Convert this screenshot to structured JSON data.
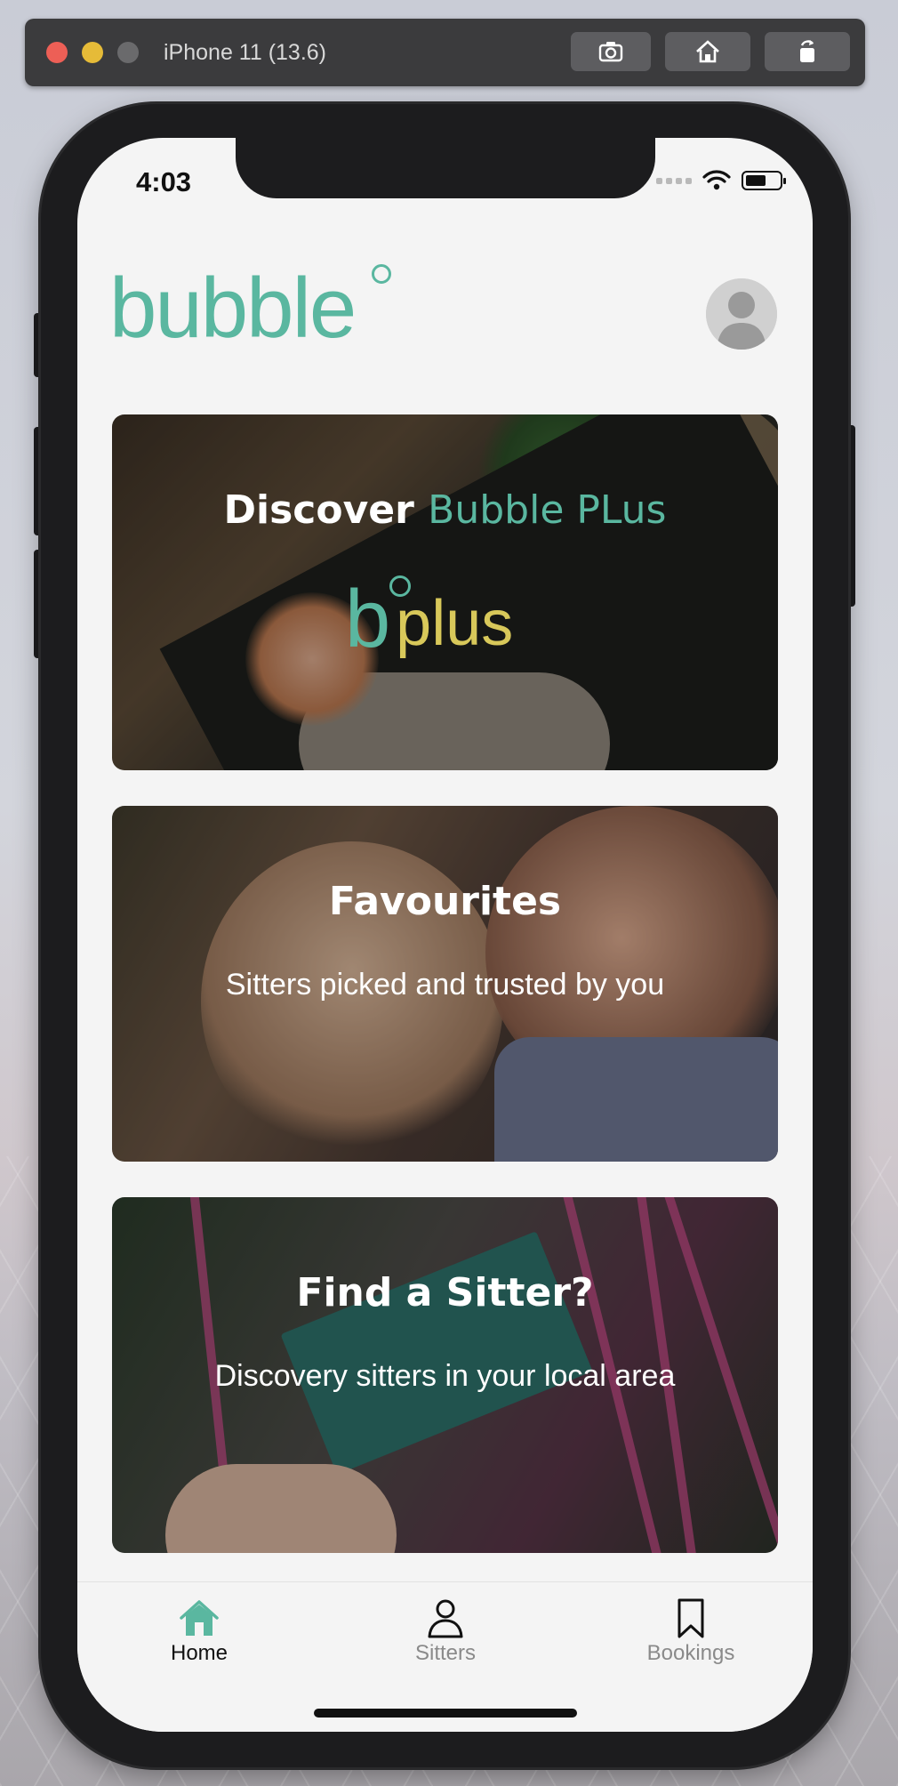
{
  "simulator": {
    "title": "iPhone 11 (13.6)"
  },
  "status_bar": {
    "time": "4:03"
  },
  "header": {
    "logo_text": "bubble"
  },
  "cards": [
    {
      "title_prefix": "Discover",
      "title_accent": "Bubble PLus",
      "logo_b": "b",
      "logo_plus": "plus"
    },
    {
      "title": "Favourites",
      "subtitle": "Sitters picked and trusted by you"
    },
    {
      "title": "Find a Sitter?",
      "subtitle": "Discovery sitters in your local area"
    }
  ],
  "tabs": [
    {
      "label": "Home",
      "icon": "home-icon",
      "active": true
    },
    {
      "label": "Sitters",
      "icon": "person-icon",
      "active": false
    },
    {
      "label": "Bookings",
      "icon": "bookmark-icon",
      "active": false
    }
  ],
  "colors": {
    "brand_teal": "#5ab7a0",
    "plus_yellow": "#d8c85a",
    "tab_inactive": "#8a8a8a"
  }
}
